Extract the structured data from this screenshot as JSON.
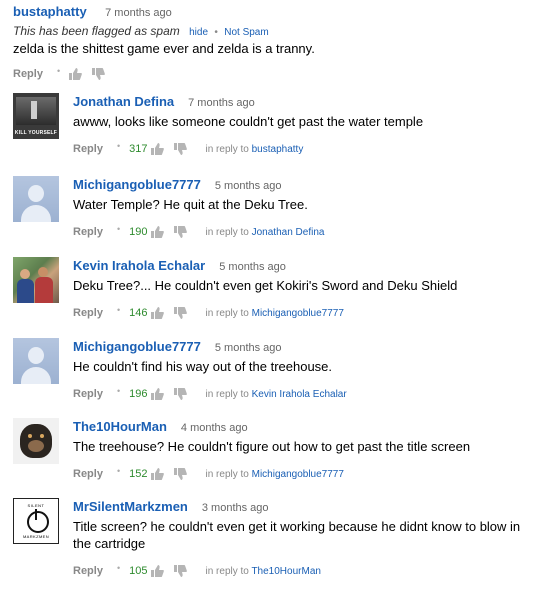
{
  "top_comment": {
    "author": "bustaphatty",
    "ago": "7 months ago",
    "flag_text": "This has been flagged as spam",
    "hide_label": "hide",
    "dot": "•",
    "not_spam_label": "Not Spam",
    "text": "zelda is the shittest game ever and zelda is a tranny.",
    "reply_label": "Reply"
  },
  "reply_label": "Reply",
  "in_reply_prefix": "in reply to",
  "avatar_kill_label": "KILL YOURSELF",
  "avatar_silent_top": "SILENT",
  "avatar_silent_bottom": "MARKZMEN",
  "comments": [
    {
      "author": "Jonathan Defina",
      "ago": "7 months ago",
      "text": "awww, looks like someone couldn't get past the water temple",
      "score": "317",
      "reply_to": "bustaphatty",
      "avatar": "kill-yourself-avatar"
    },
    {
      "author": "Michigangoblue7777",
      "ago": "5 months ago",
      "text": "Water Temple? He quit at the Deku Tree.",
      "score": "190",
      "reply_to": "Jonathan Defina",
      "avatar": "default-avatar"
    },
    {
      "author": "Kevin Irahola Echalar",
      "ago": "5 months ago",
      "text": "Deku Tree?... He couldn't even get Kokiri's Sword and Deku Shield",
      "score": "146",
      "reply_to": "Michigangoblue7777",
      "avatar": "photo-avatar"
    },
    {
      "author": "Michigangoblue7777",
      "ago": "5 months ago",
      "text": "He couldn't find his way out of the treehouse.",
      "score": "196",
      "reply_to": "Kevin Irahola Echalar",
      "avatar": "default-avatar"
    },
    {
      "author": "The10HourMan",
      "ago": "4 months ago",
      "text": "The treehouse? He couldn't figure out how to get past the title screen",
      "score": "152",
      "reply_to": "Michigangoblue7777",
      "avatar": "dog-avatar"
    },
    {
      "author": "MrSilentMarkzmen",
      "ago": "3 months ago",
      "text": "Title screen? he couldn't even get it working because he didnt know to blow in the cartridge",
      "score": "105",
      "reply_to": "The10HourMan",
      "avatar": "silent-avatar"
    }
  ],
  "colors": {
    "link": "#1a5fb4",
    "score": "#2e8b2e",
    "muted": "#888888"
  }
}
